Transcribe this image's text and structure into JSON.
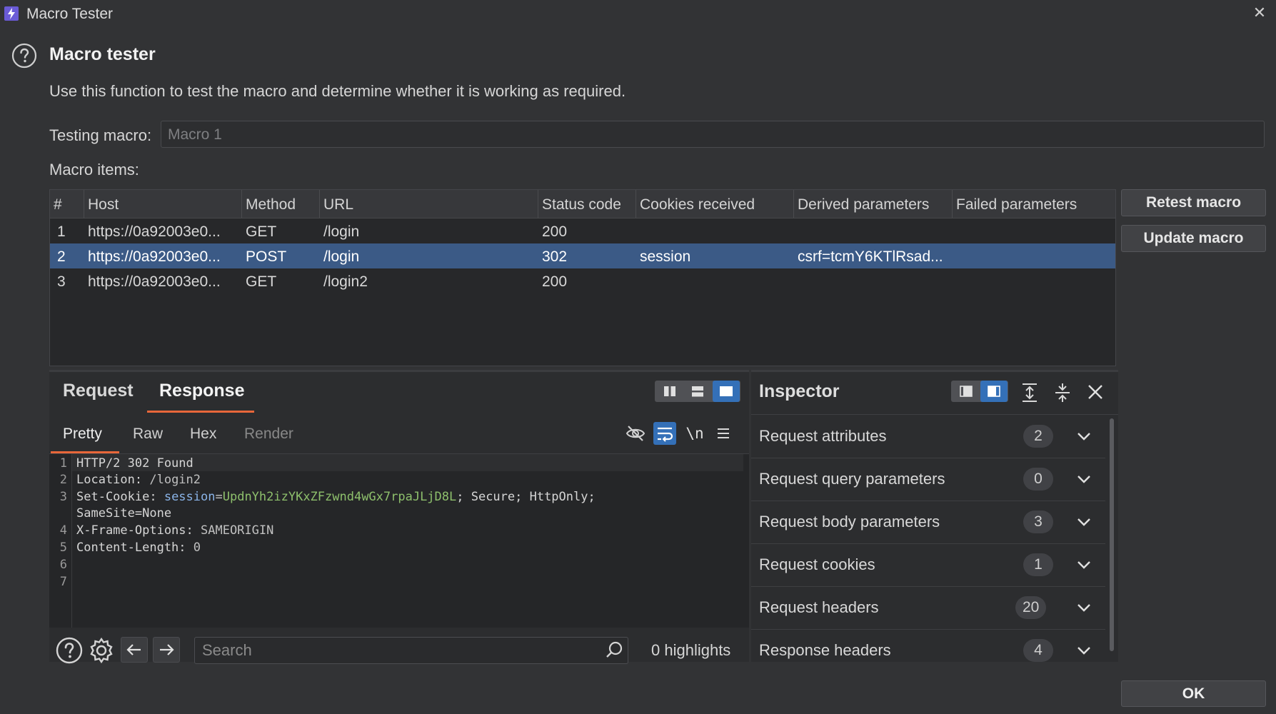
{
  "window": {
    "title": "Macro Tester",
    "close_glyph": "✕"
  },
  "header": {
    "heading": "Macro tester",
    "description": "Use this function to test the macro and determine whether it is working as required."
  },
  "testing": {
    "label": "Testing macro:",
    "value": "Macro 1"
  },
  "items_label": "Macro items:",
  "table": {
    "columns": [
      "#",
      "Host",
      "Method",
      "URL",
      "Status code",
      "Cookies received",
      "Derived parameters",
      "Failed parameters"
    ],
    "rows": [
      {
        "num": "1",
        "host": "https://0a92003e0...",
        "method": "GET",
        "url": "/login",
        "status": "200",
        "cookies": "",
        "derived": "",
        "failed": ""
      },
      {
        "num": "2",
        "host": "https://0a92003e0...",
        "method": "POST",
        "url": "/login",
        "status": "302",
        "cookies": "session",
        "derived": "csrf=tcmY6KTlRsad...",
        "failed": ""
      },
      {
        "num": "3",
        "host": "https://0a92003e0...",
        "method": "GET",
        "url": "/login2",
        "status": "200",
        "cookies": "",
        "derived": "",
        "failed": ""
      }
    ],
    "selected_row": 2
  },
  "side_buttons": {
    "retest": "Retest macro",
    "update": "Update macro"
  },
  "editor": {
    "tabs": {
      "request": "Request",
      "response": "Response"
    },
    "active_tab": "Response",
    "subtabs": {
      "pretty": "Pretty",
      "raw": "Raw",
      "hex": "Hex",
      "render": "Render"
    },
    "active_subtab": "Pretty",
    "newline_toggle": "\\n",
    "line_numbers": [
      "1",
      "2",
      "3",
      "",
      "4",
      "5",
      "6",
      "7"
    ],
    "lines": {
      "l1": "HTTP/2 302 Found",
      "l2_key": "Location:",
      "l2_val": " /login2",
      "l3_key": "Set-Cookie:",
      "l3_ck": " session",
      "l3_eq": "=",
      "l3_cookie_value": "UpdnYh2izYKxZFzwnd4wGx7rpaJLjD8L",
      "l3_rest": "; Secure; HttpOnly;",
      "l3_wrap": "SameSite=None",
      "l4_key": "X-Frame-Options:",
      "l4_val": " SAMEORIGIN",
      "l5_key": "Content-Length:",
      "l5_val": " 0"
    },
    "search": {
      "placeholder": "Search",
      "highlights": "0 highlights"
    }
  },
  "inspector": {
    "title": "Inspector",
    "sections": [
      {
        "label": "Request attributes",
        "count": "2"
      },
      {
        "label": "Request query parameters",
        "count": "0"
      },
      {
        "label": "Request body parameters",
        "count": "3"
      },
      {
        "label": "Request cookies",
        "count": "1"
      },
      {
        "label": "Request headers",
        "count": "20"
      },
      {
        "label": "Response headers",
        "count": "4"
      }
    ]
  },
  "ok_button": "OK",
  "colors": {
    "accent": "#e8673a",
    "selection": "#3b5a86",
    "active_toggle": "#3470b8",
    "app_icon": "#6a5bd6"
  }
}
